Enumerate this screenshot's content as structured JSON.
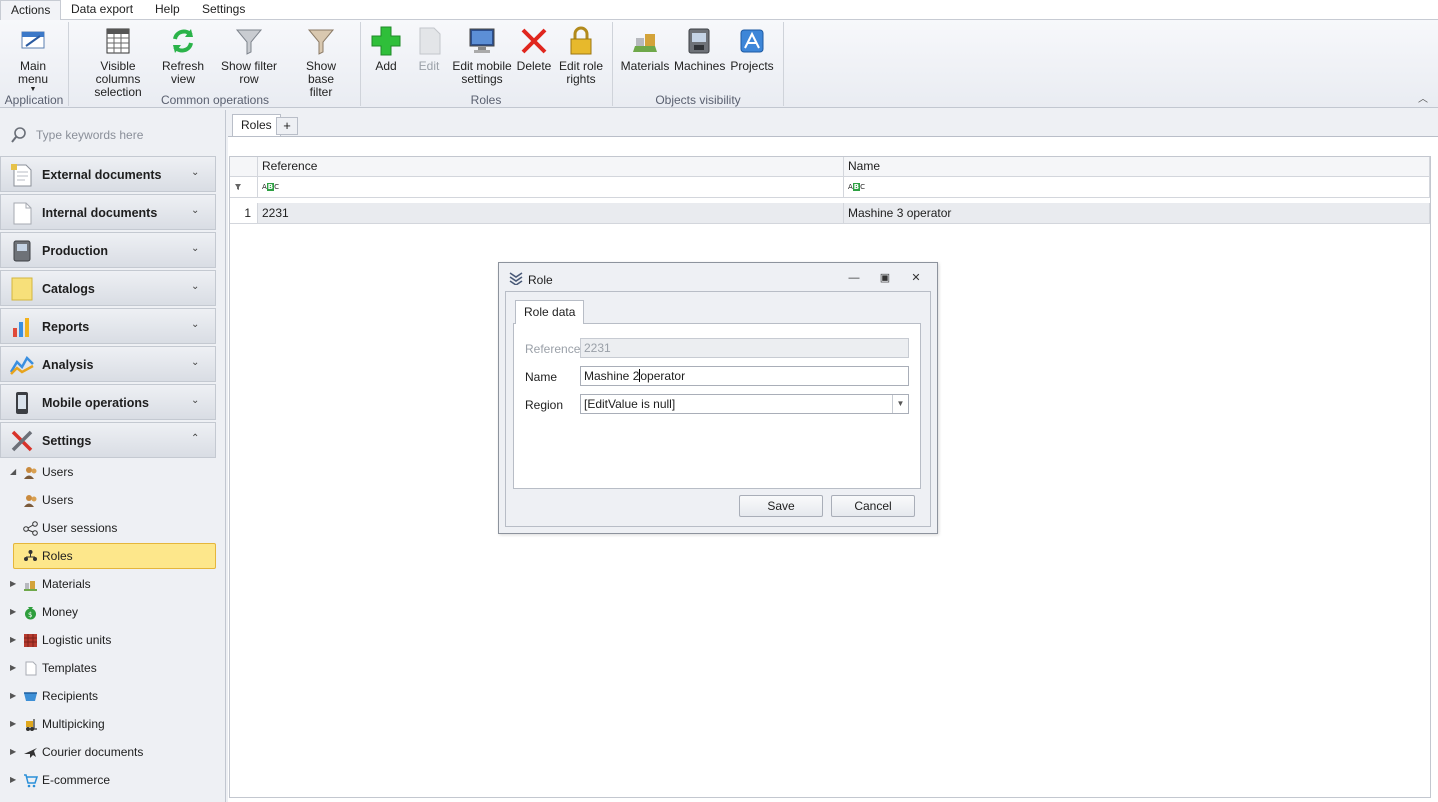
{
  "ribbon_tabs": [
    "Actions",
    "Data export",
    "Help",
    "Settings"
  ],
  "ribbon": {
    "application": {
      "group": "Application",
      "main_menu": "Main menu"
    },
    "common": {
      "group": "Common operations",
      "visible_columns": [
        "Visible columns",
        "selection"
      ],
      "refresh": [
        "Refresh",
        "view"
      ],
      "show_filter_row": "Show filter row",
      "show_base_filter": [
        "Show base",
        "filter"
      ]
    },
    "roles": {
      "group": "Roles",
      "add": "Add",
      "edit": "Edit",
      "edit_mobile": [
        "Edit mobile",
        "settings"
      ],
      "delete": "Delete",
      "edit_role_rights": [
        "Edit role",
        "rights"
      ]
    },
    "objects": {
      "group": "Objects visibility",
      "materials": "Materials",
      "machines": "Machines",
      "projects": "Projects"
    }
  },
  "leftnav": {
    "search_placeholder": "Type keywords here",
    "groups": [
      "External documents",
      "Internal documents",
      "Production",
      "Catalogs",
      "Reports",
      "Analysis",
      "Mobile operations",
      "Settings"
    ],
    "tree": [
      "Users",
      "Users",
      "User sessions",
      "Roles",
      "Materials",
      "Money",
      "Logistic units",
      "Templates",
      "Recipients",
      "Multipicking",
      "Courier documents",
      "E-commerce"
    ]
  },
  "main": {
    "tabs": [
      "Roles"
    ],
    "add_tab": "+",
    "columns": [
      "Reference",
      "Name"
    ],
    "rows": [
      {
        "num": "1",
        "reference": "2231",
        "name": "Mashine 3 operator"
      }
    ]
  },
  "dialog": {
    "title": "Role",
    "tab": "Role data",
    "reference_label": "Reference",
    "reference_value": "2231",
    "name_label": "Name",
    "name_value_before": "Mashine 2",
    "name_value_after": "operator",
    "region_label": "Region",
    "region_value": "[EditValue is null]",
    "save": "Save",
    "cancel": "Cancel"
  }
}
